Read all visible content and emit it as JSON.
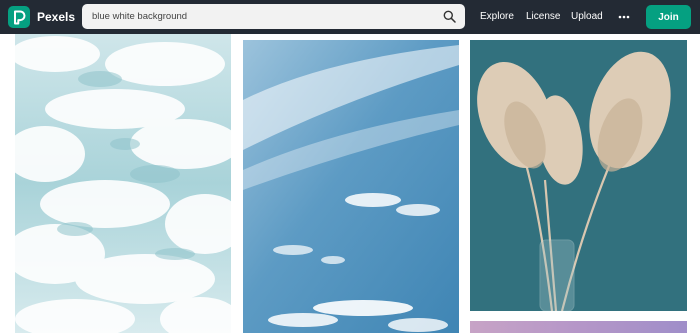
{
  "header": {
    "brand": "Pexels",
    "search": {
      "value": "blue white background"
    },
    "nav": {
      "explore": "Explore",
      "license": "License",
      "upload": "Upload"
    },
    "join_label": "Join"
  },
  "icons": {
    "logo": "pexels-logo-icon",
    "search": "search-icon",
    "more": "more-horizontal-icon"
  },
  "colors": {
    "nav_background": "#232a34",
    "brand_green": "#05a081",
    "search_background": "#f2f2f2"
  },
  "photos": [
    {
      "subject": "ocean foam"
    },
    {
      "subject": "blue sky with clouds"
    },
    {
      "subject": "pampas grass in glass vase"
    },
    {
      "subject": "pink sky"
    }
  ]
}
